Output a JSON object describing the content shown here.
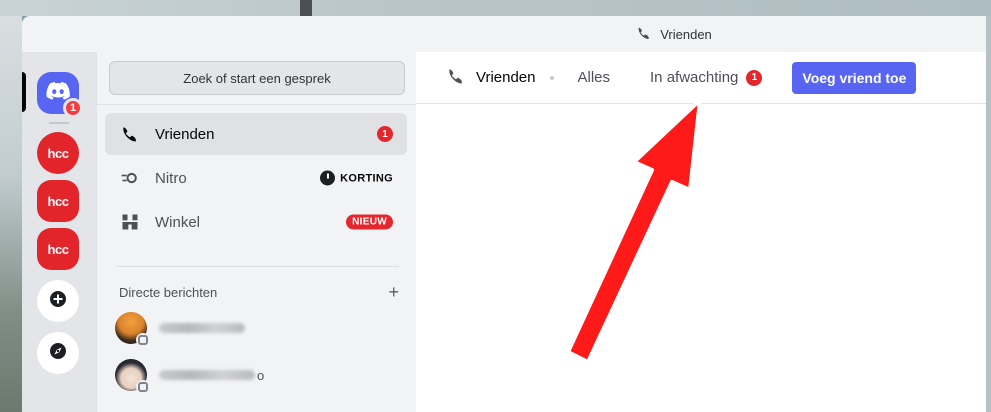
{
  "window": {
    "title": "Vrienden",
    "title_icon": "friends-icon"
  },
  "rail": {
    "discord_badge": "1",
    "servers": [
      {
        "label": "hcc",
        "icon": "hcc-server-icon"
      },
      {
        "label": "hcc",
        "icon": "hcc-drones-server-icon"
      },
      {
        "label": "hcc",
        "icon": "hcc-server-icon"
      }
    ],
    "add_icon": "plus-circle-icon",
    "explore_icon": "compass-icon"
  },
  "sidebar": {
    "search_placeholder": "Zoek of start een gesprek",
    "items": [
      {
        "label": "Vrienden",
        "icon": "friends-icon",
        "badge": "1",
        "active": true
      },
      {
        "label": "Nitro",
        "icon": "nitro-icon",
        "tag": "KORTING"
      },
      {
        "label": "Winkel",
        "icon": "shop-icon",
        "tag": "NIEUW"
      }
    ],
    "dm_header": "Directe berichten",
    "dm_add": "+",
    "dms": [
      {
        "name_visible_suffix": "",
        "avatar": "avatar-sunset"
      },
      {
        "name_visible_suffix": "o",
        "avatar": "avatar-anime"
      }
    ]
  },
  "main": {
    "title": "Vrienden",
    "tabs": [
      {
        "label": "Alles"
      },
      {
        "label": "In afwachting",
        "badge": "1"
      }
    ],
    "add_friend_label": "Voeg vriend toe"
  },
  "colors": {
    "accent": "#5865f2",
    "badge_red": "#e4262d",
    "annotation_arrow": "#ff1a1a"
  }
}
